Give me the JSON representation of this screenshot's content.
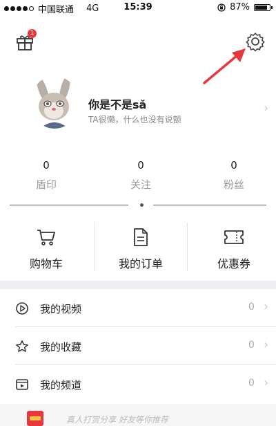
{
  "status_bar": {
    "carrier": "中国联通",
    "network": "4G",
    "time": "15:39",
    "battery": "87%",
    "battery_level": 0.87
  },
  "header": {
    "gift_badge": "1",
    "icons": {
      "left": "gift-icon",
      "right": "gear-icon"
    },
    "annotation": "red-arrow"
  },
  "profile": {
    "username": "你是不是sǎ",
    "bio": "TA很懒，什么也没有说额"
  },
  "stats": [
    {
      "value": "0",
      "label": "盾印"
    },
    {
      "value": "0",
      "label": "关注"
    },
    {
      "value": "0",
      "label": "粉丝"
    }
  ],
  "shortcuts": [
    {
      "label": "购物车",
      "icon": "shopping-cart-icon"
    },
    {
      "label": "我的订单",
      "icon": "order-document-icon"
    },
    {
      "label": "优惠券",
      "icon": "coupon-icon"
    }
  ],
  "menu": [
    {
      "label": "我的视频",
      "count": "0",
      "icon": "video-play-icon"
    },
    {
      "label": "我的收藏",
      "count": "0",
      "icon": "star-icon"
    },
    {
      "label": "我的频道",
      "count": "0",
      "icon": "channel-icon"
    }
  ],
  "footer": {
    "text": "真人打赏分享 好友等你推荐"
  },
  "colors": {
    "badge": "#e8383d",
    "arrow": "#e8383d",
    "band": "#eeeef2"
  }
}
